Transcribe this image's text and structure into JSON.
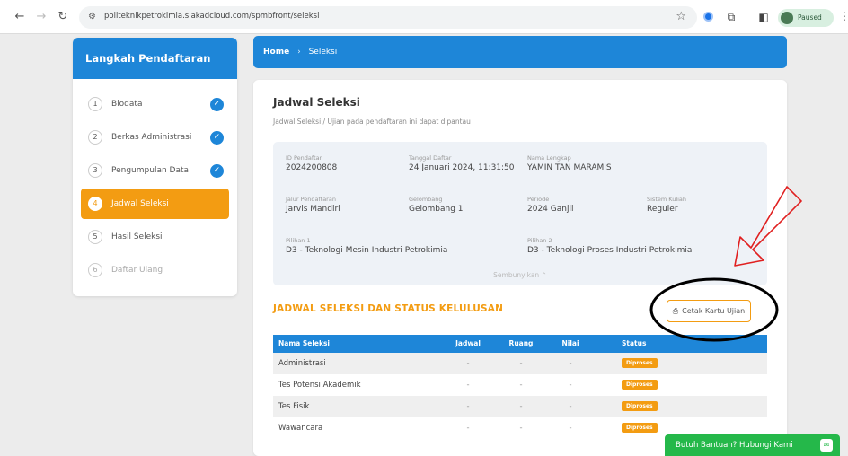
{
  "browser": {
    "url": "politeknikpetrokimia.siakadcloud.com/spmbfront/seleksi",
    "profile_label": "Paused",
    "colors": {
      "profile_bg": "#d8efe0"
    }
  },
  "sidebar": {
    "title": "Langkah Pendaftaran",
    "steps": [
      {
        "num": "1",
        "label": "Biodata",
        "state": "done"
      },
      {
        "num": "2",
        "label": "Berkas Administrasi",
        "state": "done"
      },
      {
        "num": "3",
        "label": "Pengumpulan Data",
        "state": "done"
      },
      {
        "num": "4",
        "label": "Jadwal Seleksi",
        "state": "active"
      },
      {
        "num": "5",
        "label": "Hasil Seleksi",
        "state": "pending"
      },
      {
        "num": "6",
        "label": "Daftar Ulang",
        "state": "disabled"
      }
    ]
  },
  "breadcrumb": {
    "home": "Home",
    "separator": "›",
    "current": "Seleksi"
  },
  "card": {
    "title": "Jadwal Seleksi",
    "subtitle": "Jadwal Seleksi / Ujian pada pendaftaran ini dapat dipantau",
    "info": {
      "id_label": "ID Pendaftar",
      "id_value": "2024200808",
      "tgl_label": "Tanggal Daftar",
      "tgl_value": "24 Januari 2024, 11:31:50",
      "nama_label": "Nama Lengkap",
      "nama_value": "YAMIN TAN MARAMIS",
      "jalur_label": "Jalur Pendaftaran",
      "jalur_value": "Jarvis Mandiri",
      "gel_label": "Gelombang",
      "gel_value": "Gelombang 1",
      "periode_label": "Periode",
      "periode_value": "2024 Ganjil",
      "sistem_label": "Sistem Kuliah",
      "sistem_value": "Reguler",
      "p1_label": "Pilihan 1",
      "p1_value": "D3 - Teknologi Mesin Industri Petrokimia",
      "p2_label": "Pilihan 2",
      "p2_value": "D3 - Teknologi Proses Industri Petrokimia",
      "toggle": "Sembunyikan ⌃"
    },
    "section_title": "JADWAL SELEKSI DAN STATUS KELULUSAN",
    "print_button": "Cetak Kartu Ujian",
    "table": {
      "headers": {
        "name": "Nama Seleksi",
        "jadwal": "Jadwal",
        "ruang": "Ruang",
        "nilai": "Nilai",
        "status": "Status"
      },
      "rows": [
        {
          "name": "Administrasi",
          "jadwal": "-",
          "ruang": "-",
          "nilai": "-",
          "status": "Diproses"
        },
        {
          "name": "Tes Potensi Akademik",
          "jadwal": "-",
          "ruang": "-",
          "nilai": "-",
          "status": "Diproses"
        },
        {
          "name": "Tes Fisik",
          "jadwal": "-",
          "ruang": "-",
          "nilai": "-",
          "status": "Diproses"
        },
        {
          "name": "Wawancara",
          "jadwal": "-",
          "ruang": "-",
          "nilai": "-",
          "status": "Diproses"
        }
      ]
    }
  },
  "help_button": "Butuh Bantuan? Hubungi Kami",
  "colors": {
    "primary": "#1e86d8",
    "accent": "#f39c12",
    "success": "#25b84a",
    "annotation": "#e02020"
  }
}
